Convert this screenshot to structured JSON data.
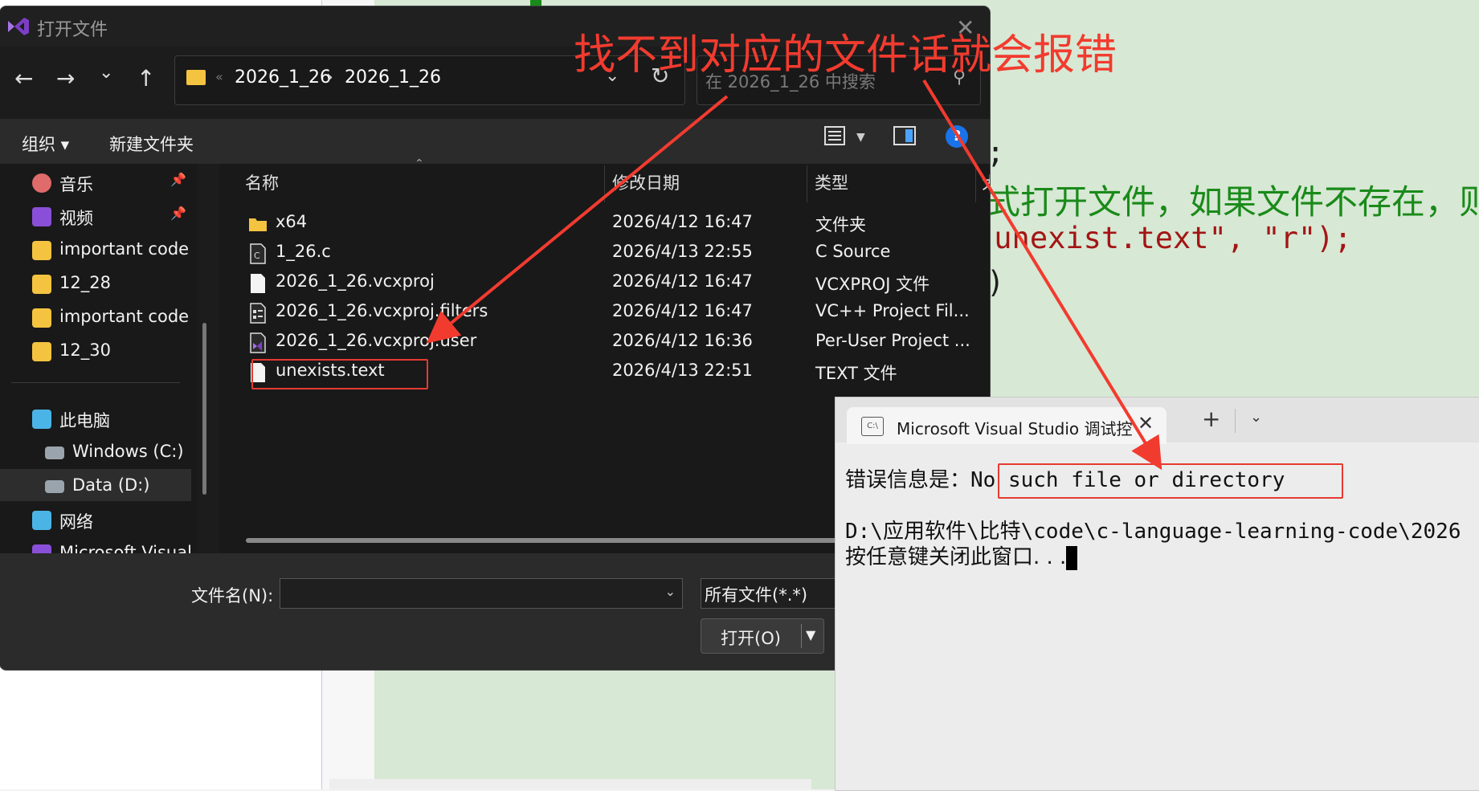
{
  "editor": {
    "code_lines": [
      ";",
      "式打开文件，如果文件不存在，则",
      "\"unexist.text\", \"r\");",
      ")"
    ],
    "code_colors": {
      "string": "#a31515",
      "comment": "#1a8a1a",
      "text": "#1e1e1e"
    }
  },
  "dialog": {
    "title": "打开文件",
    "nav": {
      "back": "←",
      "forward": "→",
      "recent": "⌄",
      "up": "↑"
    },
    "address": {
      "crumbs": [
        "2026_1_26",
        "2026_1_26"
      ],
      "separator": "›",
      "overflow": "«"
    },
    "search_placeholder": "在 2026_1_26 中搜索",
    "toolbar": {
      "organize": "组织 ▾",
      "new_folder": "新建文件夹"
    },
    "sidebar": [
      {
        "label": "音乐",
        "icon": "music-icon",
        "pinned": true
      },
      {
        "label": "视频",
        "icon": "video-icon",
        "pinned": true
      },
      {
        "label": "important code :",
        "icon": "folder-sync-icon",
        "pinned": false
      },
      {
        "label": "12_28",
        "icon": "folder-sync-icon",
        "pinned": false
      },
      {
        "label": "important code :",
        "icon": "folder-sync-icon",
        "pinned": false
      },
      {
        "label": "12_30",
        "icon": "folder-sync-icon",
        "pinned": false
      },
      {
        "label": "此电脑",
        "icon": "computer-icon",
        "pinned": false
      },
      {
        "label": "Windows (C:)",
        "icon": "drive-icon",
        "pinned": false
      },
      {
        "label": "Data (D:)",
        "icon": "drive-icon",
        "pinned": false
      },
      {
        "label": "网络",
        "icon": "network-icon",
        "pinned": false
      },
      {
        "label": "Microsoft Visual",
        "icon": "visual-studio-icon",
        "pinned": false
      }
    ],
    "columns": {
      "name": "名称",
      "date": "修改日期",
      "type": "类型",
      "size": "大"
    },
    "files": [
      {
        "name": "x64",
        "date": "2026/4/12 16:47",
        "type": "文件夹",
        "icon": "folder-icon"
      },
      {
        "name": "1_26.c",
        "date": "2026/4/13 22:55",
        "type": "C Source",
        "icon": "c-source-icon"
      },
      {
        "name": "2026_1_26.vcxproj",
        "date": "2026/4/12 16:47",
        "type": "VCXPROJ 文件",
        "icon": "file-icon"
      },
      {
        "name": "2026_1_26.vcxproj.filters",
        "date": "2026/4/12 16:47",
        "type": "VC++ Project Fil...",
        "icon": "filters-file-icon"
      },
      {
        "name": "2026_1_26.vcxproj.user",
        "date": "2026/4/12 16:36",
        "type": "Per-User Project ...",
        "icon": "vs-user-file-icon"
      },
      {
        "name": "unexists.text",
        "date": "2026/4/13 22:51",
        "type": "TEXT 文件",
        "icon": "file-icon"
      }
    ],
    "filename_label": "文件名(N):",
    "filename_value": "",
    "filter_value": "所有文件(*.*)",
    "open_button": "打开(O)"
  },
  "console": {
    "tab_title": "Microsoft Visual Studio 调试控",
    "tab_icon_text": "C:\\",
    "new_tab": "+",
    "line1_label": "错误信息是：",
    "line1_error": "No such file or directory",
    "line2": "D:\\应用软件\\比特\\code\\c-language-learning-code\\2026",
    "line3": "按任意键关闭此窗口. . ."
  },
  "annotation": {
    "title": "找不到对应的文件话就会报错",
    "color": "#f23b2f"
  }
}
